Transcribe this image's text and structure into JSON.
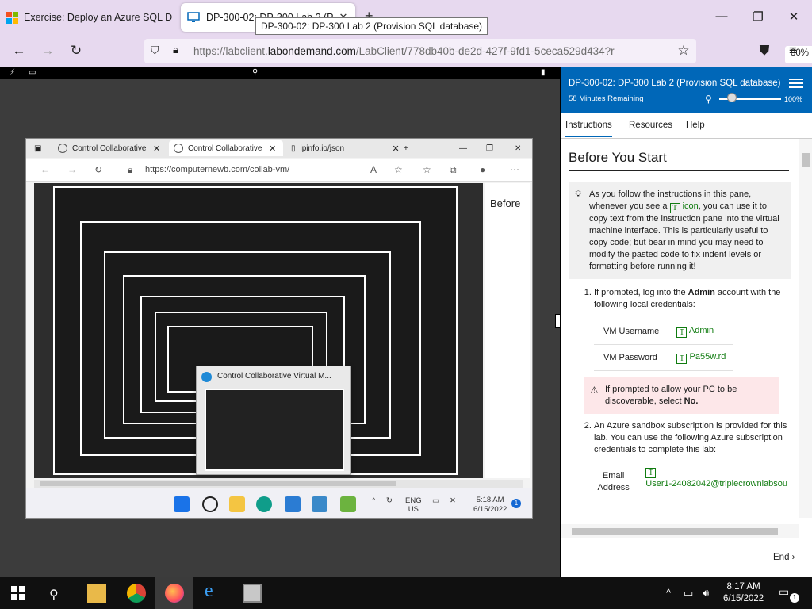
{
  "firefox": {
    "tabs": [
      {
        "label": "Exercise: Deploy an Azure SQL D",
        "active": false
      },
      {
        "label": "DP-300-02: DP-300 Lab 2 (P",
        "active": true
      }
    ],
    "tooltip": "DP-300-02: DP-300 Lab 2 (Provision SQL database)",
    "url_prefix": "https://labclient.",
    "url_domain": "labondemand.com",
    "url_rest": "/LabClient/778db40b-de2d-427f-9fd1-5ceca529d434?r",
    "zoom": "80%"
  },
  "vm": {
    "edge_tabs": [
      {
        "label": "Control Collaborative"
      },
      {
        "label": "Control Collaborative"
      },
      {
        "label": "ipinfo.io/json"
      }
    ],
    "edge_url": "https://computernewb.com/collab-vm/",
    "sidebar_heading": "Before",
    "popup_title": "Control Collaborative Virtual M...",
    "taskbar": {
      "lang_top": "ENG",
      "lang_bottom": "US",
      "time": "5:18 AM",
      "date": "6/15/2022",
      "notification_count": "1"
    }
  },
  "panel": {
    "title": "DP-300-02: DP-300 Lab 2 (Provision SQL database)",
    "remaining": "58 Minutes Remaining",
    "zoom_percent": "100%",
    "tabs": [
      "Instructions",
      "Resources",
      "Help"
    ],
    "heading": "Before You Start",
    "note_before": "As you follow the instructions in this pane, whenever you see a",
    "note_icon_word": "icon",
    "note_after": ", you can use it to copy text from the instruction pane into the virtual machine interface. This is particularly useful to copy code; but bear in mind you may need to modify the pasted code to fix indent levels or formatting before running it!",
    "step1_before": "If prompted, log into the",
    "step1_bold": "Admin",
    "step1_after": "account with the following local credentials:",
    "vm_username_label": "VM Username",
    "vm_username": "Admin",
    "vm_password_label": "VM Password",
    "vm_password": "Pa55w.rd",
    "warning_before": "If prompted to allow your PC to be discoverable, select",
    "warning_bold": "No.",
    "step2": "An Azure sandbox subscription is provided for this lab. You can use the following Azure subscription credentials to complete this lab:",
    "email_label_1": "Email",
    "email_label_2": "Address",
    "email_value": "User1-24082042@triplecrownlabsou",
    "end_label": "End",
    "t_glyph": "T"
  },
  "taskbar": {
    "time": "8:17 AM",
    "date": "6/15/2022",
    "notification_count": "1"
  }
}
